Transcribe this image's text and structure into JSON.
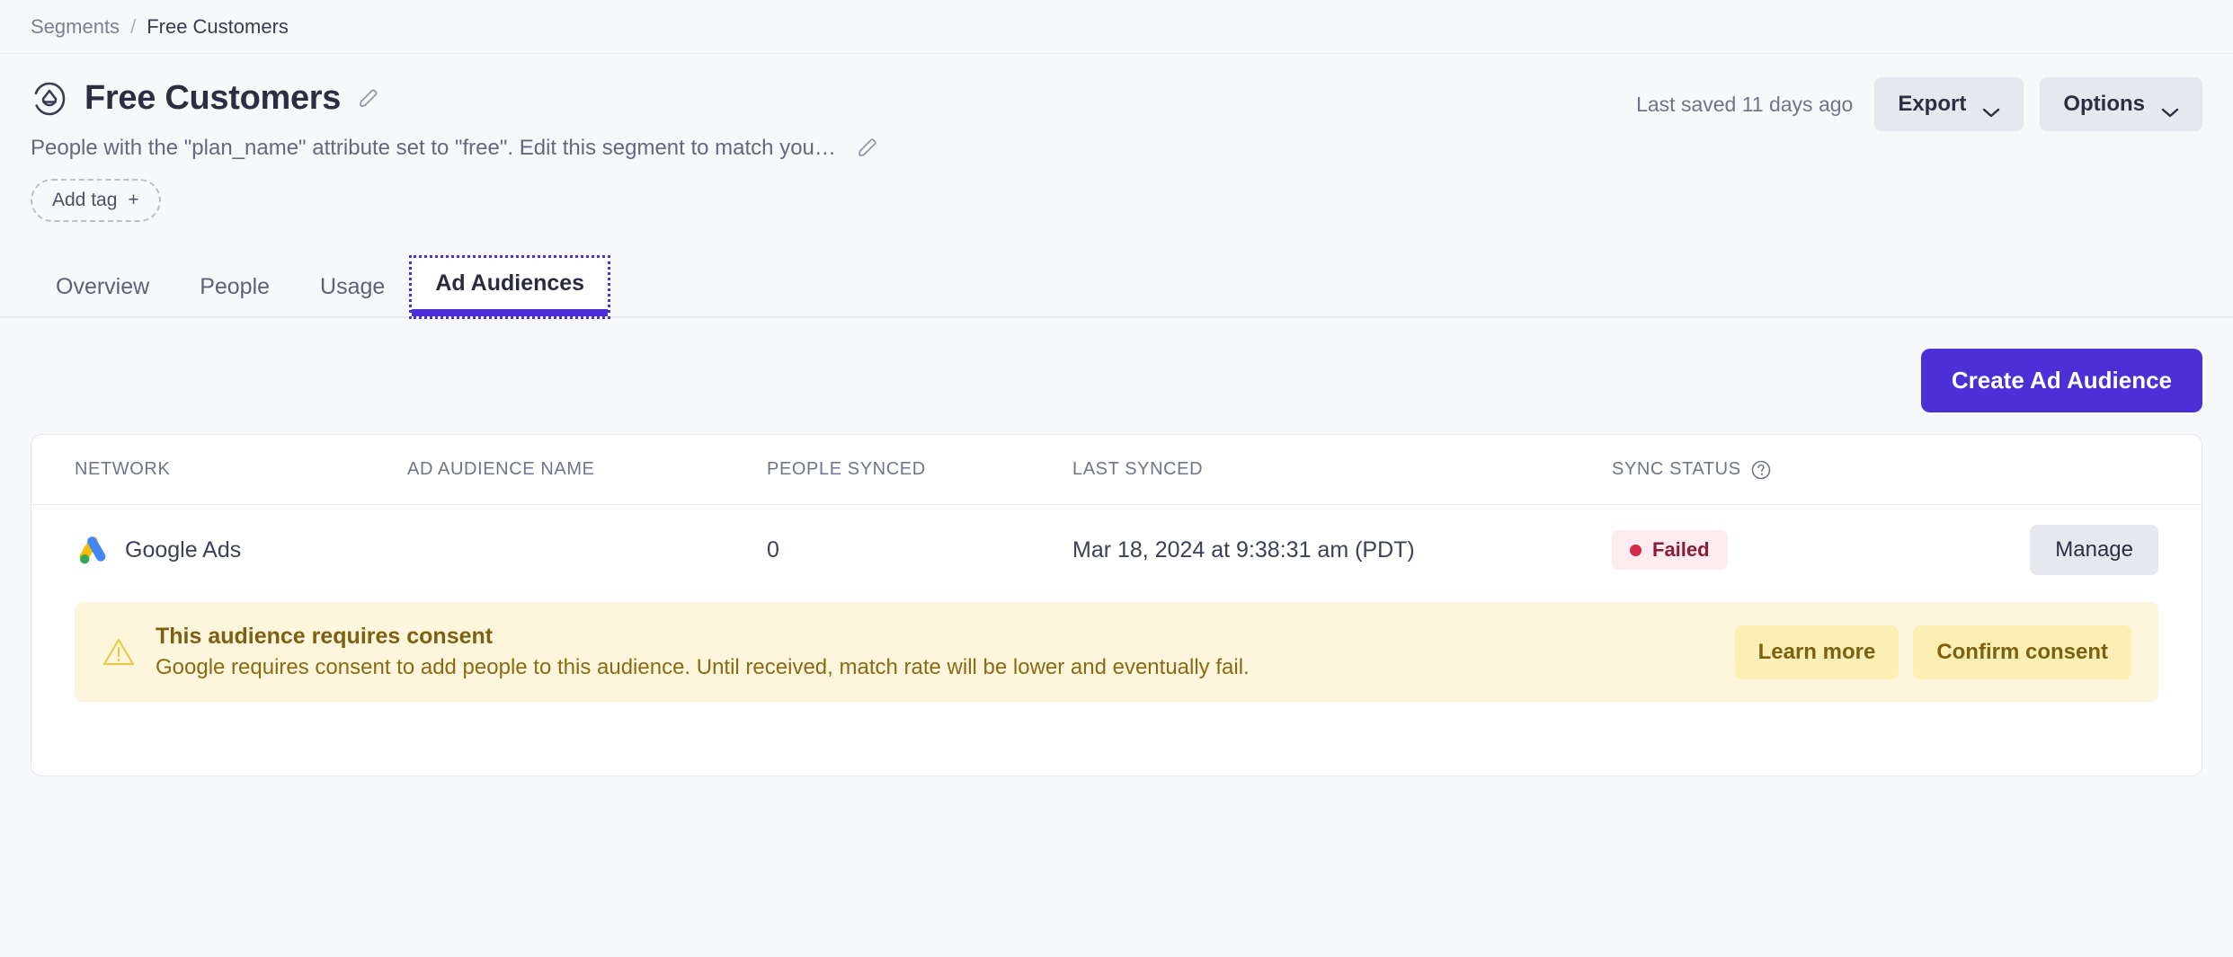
{
  "breadcrumb": {
    "parent": "Segments",
    "separator": "/",
    "current": "Free Customers"
  },
  "header": {
    "title": "Free Customers",
    "description": "People with the \"plan_name\" attribute set to \"free\". Edit this segment to match you…",
    "add_tag_label": "Add tag",
    "add_tag_plus": "+",
    "last_saved": "Last saved 11 days ago",
    "export_label": "Export",
    "options_label": "Options",
    "segment_icon": "segment-cloud-icon",
    "edit_title_icon": "pencil-icon",
    "edit_description_icon": "pencil-icon"
  },
  "tabs": [
    {
      "label": "Overview",
      "active": false
    },
    {
      "label": "People",
      "active": false
    },
    {
      "label": "Usage",
      "active": false
    },
    {
      "label": "Ad Audiences",
      "active": true
    }
  ],
  "actions": {
    "create_label": "Create Ad Audience"
  },
  "table": {
    "columns": [
      {
        "key": "network",
        "label": "NETWORK"
      },
      {
        "key": "name",
        "label": "AD AUDIENCE NAME"
      },
      {
        "key": "people_synced",
        "label": "PEOPLE SYNCED"
      },
      {
        "key": "last_synced",
        "label": "LAST SYNCED"
      },
      {
        "key": "sync_status",
        "label": "SYNC STATUS",
        "help_icon": "question-circle-icon"
      }
    ],
    "rows": [
      {
        "network": "Google Ads",
        "network_icon": "google-ads-icon",
        "name": "",
        "people_synced": "0",
        "last_synced": "Mar 18, 2024 at 9:38:31 am (PDT)",
        "status": "Failed",
        "status_color": "#d42a47",
        "action_label": "Manage"
      }
    ]
  },
  "banner": {
    "icon": "warning-triangle-icon",
    "title": "This audience requires consent",
    "body": "Google requires consent to add people to this audience. Until received, match rate will be lower and eventually fail.",
    "learn_more_label": "Learn more",
    "confirm_label": "Confirm consent"
  },
  "colors": {
    "accent": "#4c2fd7",
    "warning_bg": "#fdf6dd",
    "warning_text": "#7d6010",
    "danger": "#d42a47",
    "page_bg": "#f7f8fa"
  }
}
